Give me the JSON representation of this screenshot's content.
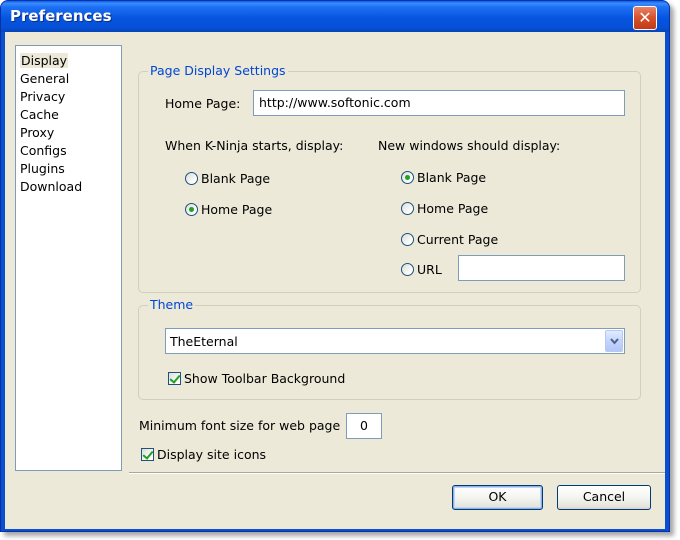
{
  "window": {
    "title": "Preferences",
    "close_glyph": "✕"
  },
  "sidebar": {
    "items": [
      {
        "label": "Display",
        "selected": true
      },
      {
        "label": "General"
      },
      {
        "label": "Privacy"
      },
      {
        "label": "Cache"
      },
      {
        "label": "Proxy"
      },
      {
        "label": "Configs"
      },
      {
        "label": "Plugins"
      },
      {
        "label": "Download"
      }
    ]
  },
  "page_display": {
    "group_title": "Page Display Settings",
    "home_page_label": "Home Page:",
    "home_page_value": "http://www.softonic.com",
    "startup_label": "When K-Ninja starts, display:",
    "startup_options": [
      {
        "label": "Blank Page",
        "checked": false
      },
      {
        "label": "Home Page",
        "checked": true
      }
    ],
    "new_window_label": "New windows should display:",
    "new_window_options": [
      {
        "label": "Blank Page",
        "checked": true
      },
      {
        "label": "Home Page",
        "checked": false
      },
      {
        "label": "Current Page",
        "checked": false
      },
      {
        "label": "URL",
        "checked": false
      }
    ],
    "url_value": ""
  },
  "theme": {
    "group_title": "Theme",
    "selected": "TheEternal",
    "show_toolbar_bg_label": "Show Toolbar Background",
    "show_toolbar_bg_checked": true
  },
  "font": {
    "min_font_label": "Minimum font size for web page",
    "min_font_value": "0"
  },
  "site_icons": {
    "label": "Display site icons",
    "checked": true
  },
  "buttons": {
    "ok": "OK",
    "cancel": "Cancel"
  },
  "colors": {
    "titlebar": "#0654e0",
    "group_title": "#0046d5",
    "dialog_bg": "#ece9d8",
    "radio_dot": "#21a121"
  }
}
